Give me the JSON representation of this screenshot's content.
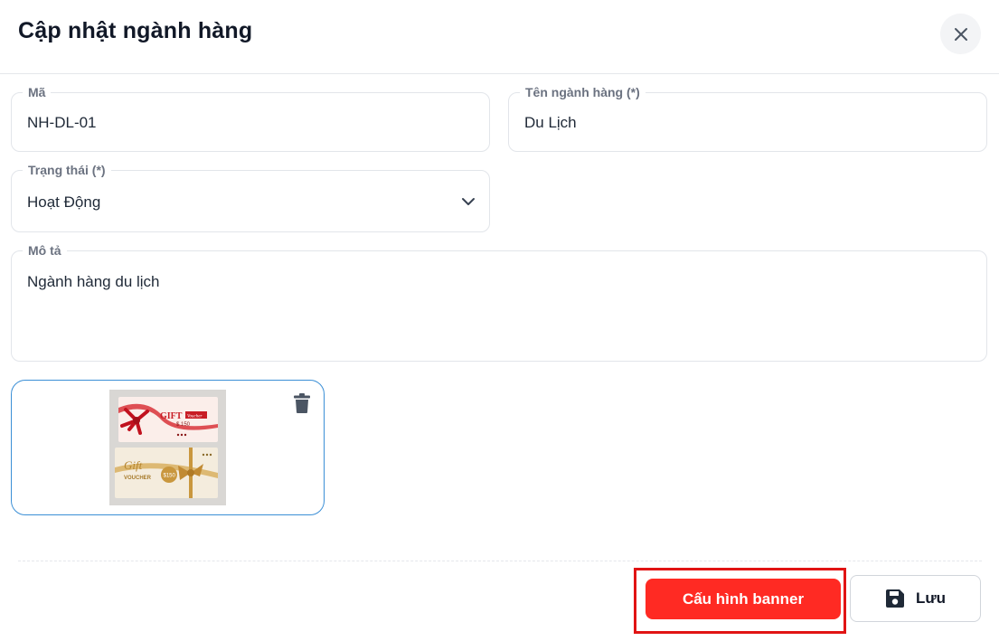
{
  "header": {
    "title": "Cập nhật ngành hàng",
    "close_icon": "close-icon"
  },
  "form": {
    "code": {
      "label": "Mã",
      "value": "NH-DL-01"
    },
    "name": {
      "label": "Tên ngành hàng (*)",
      "value": "Du Lịch"
    },
    "status": {
      "label": "Trạng thái (*)",
      "value": "Hoạt Động",
      "icon": "chevron-down-icon"
    },
    "description": {
      "label": "Mô tả",
      "value": "Ngành hàng du lịch"
    }
  },
  "image": {
    "icon": "trash-icon",
    "card_top": {
      "word": "GIFT",
      "tag": "Voucher",
      "price": "$ 150"
    },
    "card_bottom": {
      "word": "Gift",
      "tag": "VOUCHER",
      "price": "$150"
    }
  },
  "footer": {
    "banner_button": "Cấu hình banner",
    "save_button": "Lưu",
    "save_icon": "floppy-disk-icon"
  },
  "colors": {
    "primary": "#ff2a23",
    "highlight": "#e11414",
    "upload_border": "#3b8fd6"
  }
}
